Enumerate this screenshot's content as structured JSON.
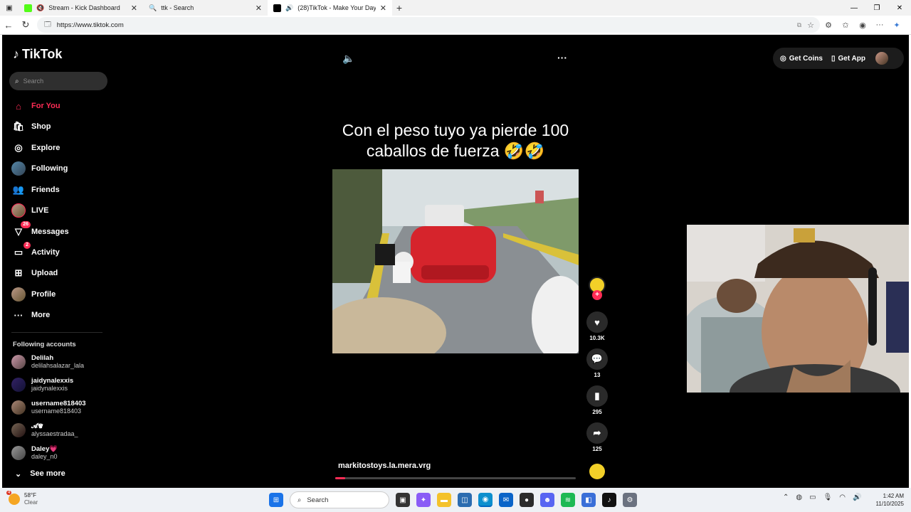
{
  "browser": {
    "tabs": [
      {
        "label": "Stream - Kick Dashboard",
        "icon": "kick-icon",
        "color": "#53fc18"
      },
      {
        "label": "ttk - Search",
        "icon": "search-icon",
        "color": "#4a90e2"
      },
      {
        "label": "(28)TikTok - Make Your Day",
        "icon": "tiktok-icon",
        "color": "#000000"
      }
    ],
    "url": "https://www.tiktok.com"
  },
  "tiktok": {
    "logo": "TikTok",
    "search_placeholder": "Search",
    "nav": [
      {
        "label": "For You",
        "icon": "home-icon",
        "active": true
      },
      {
        "label": "Shop",
        "icon": "shop-icon"
      },
      {
        "label": "Explore",
        "icon": "compass-icon"
      },
      {
        "label": "Following",
        "icon": "following-avatar"
      },
      {
        "label": "Friends",
        "icon": "friends-icon"
      },
      {
        "label": "LIVE",
        "icon": "live-avatar"
      },
      {
        "label": "Messages",
        "icon": "messages-icon",
        "badge": "26"
      },
      {
        "label": "Activity",
        "icon": "activity-icon",
        "badge": "2"
      },
      {
        "label": "Upload",
        "icon": "upload-icon"
      },
      {
        "label": "Profile",
        "icon": "profile-avatar"
      },
      {
        "label": "More",
        "icon": "more-icon"
      }
    ],
    "following_header": "Following accounts",
    "accounts": [
      {
        "name": "Delilah",
        "handle": "delilahsalazar_lala"
      },
      {
        "name": "jaidynalexxis",
        "handle": "jaidynalexxis"
      },
      {
        "name": "username818403",
        "handle": "username818403"
      },
      {
        "name": "𝓐♕",
        "handle": "alyssaestradaa_"
      },
      {
        "name": "Daley💗",
        "handle": "daley_n0"
      }
    ],
    "see_more": "See more",
    "get_coins": "Get Coins",
    "get_app": "Get App",
    "caption": "Con el peso tuyo ya pierde 100 caballos de fuerza 🤣🤣",
    "username": "markitostoys.la.mera.vrg",
    "progress": 0.04,
    "likes": "10.3K",
    "comments": "13",
    "saves": "295",
    "shares": "125"
  },
  "taskbar": {
    "temp": "58°F",
    "condition": "Clear",
    "weather_badge": "4",
    "search": "Search",
    "time": "1:42 AM",
    "date": "11/10/2025"
  }
}
